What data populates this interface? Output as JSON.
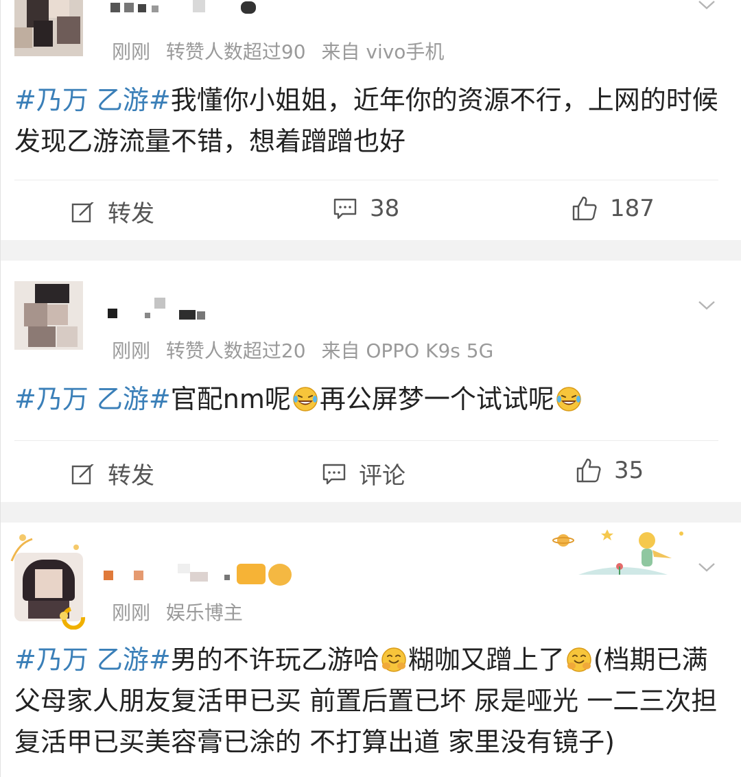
{
  "posts": [
    {
      "meta": {
        "time": "刚刚",
        "tag": "转赞人数超过90",
        "source": "来自 vivo手机"
      },
      "content": {
        "topic": "#乃万 乙游#",
        "text": "我懂你小姐姐，近年你的资源不行，上网的时候发现乙游流量不错，想着蹭蹭也好"
      },
      "actions": {
        "repost": "转发",
        "comment": "38",
        "like": "187"
      }
    },
    {
      "meta": {
        "time": "刚刚",
        "tag": "转赞人数超过20",
        "source": "来自 OPPO K9s 5G"
      },
      "content": {
        "topic": "#乃万 乙游#",
        "text_a": "官配nm呢",
        "text_b": "再公屏梦一个试试呢"
      },
      "actions": {
        "repost": "转发",
        "comment": "评论",
        "like": "35"
      }
    },
    {
      "meta": {
        "time": "刚刚",
        "tag": "娱乐博主"
      },
      "content": {
        "topic": "#乃万 乙游#",
        "text_a": "男的不许玩乙游哈",
        "text_b": "糊咖又蹭上了",
        "text_c": "(档期已满 父母家人朋友复活甲已买 前置后置已坏 尿是哑光 一二三次担复活甲已买美容膏已涂的 不打算出道 家里没有镜子)"
      }
    }
  ],
  "icons": {
    "repost": "repost-icon",
    "comment": "comment-icon",
    "like": "like-icon",
    "menu": "chevron-down-icon",
    "emoji_laugh": "laughing-tears-emoji",
    "emoji_hug": "hugging-emoji"
  },
  "colors": {
    "topic": "#3a7fb8",
    "meta": "#9a9a9a",
    "separator": "#f2f2f2"
  }
}
